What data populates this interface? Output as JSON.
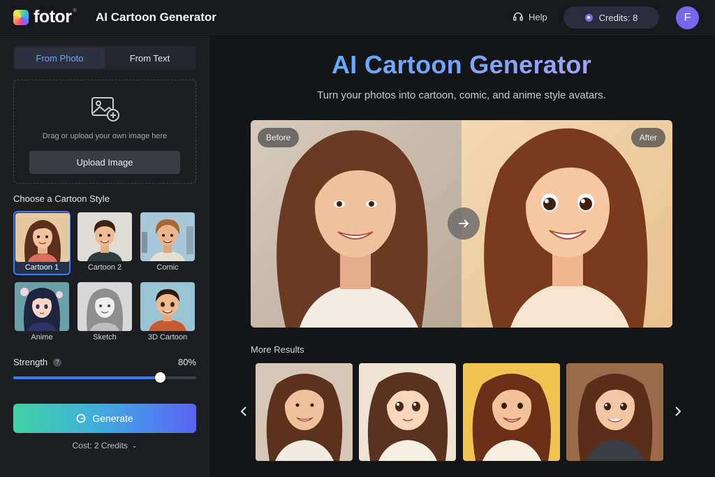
{
  "header": {
    "logo_text": "fotor",
    "logo_trademark": "®",
    "app_title": "AI Cartoon Generator",
    "help_label": "Help",
    "credits_label": "Credits: 8",
    "avatar_initial": "F"
  },
  "sidebar": {
    "tabs": [
      {
        "label": "From Photo",
        "active": true
      },
      {
        "label": "From Text",
        "active": false
      }
    ],
    "upload": {
      "hint": "Drag or upload your own image here",
      "button_label": "Upload Image"
    },
    "style_section_label": "Choose a Cartoon Style",
    "styles": [
      {
        "label": "Cartoon 1",
        "selected": true
      },
      {
        "label": "Cartoon 2",
        "selected": false
      },
      {
        "label": "Comic",
        "selected": false
      },
      {
        "label": "Anime",
        "selected": false
      },
      {
        "label": "Sketch",
        "selected": false
      },
      {
        "label": "3D Cartoon",
        "selected": false
      }
    ],
    "strength": {
      "label": "Strength",
      "value_label": "80%",
      "value": 0.8
    },
    "generate_label": "Generate",
    "cost_label": "Cost: 2 Credits"
  },
  "main": {
    "title": "AI Cartoon Generator",
    "subtitle": "Turn your photos into cartoon, comic, and anime style avatars.",
    "compare": {
      "before_label": "Before",
      "after_label": "After"
    },
    "more_results_label": "More Results"
  },
  "colors": {
    "accent": "#3f7cf5",
    "background": "#141517",
    "sidebar": "#1d1e22",
    "credits_pill": "#2a2c3d",
    "avatar": "#7b66f0"
  },
  "icons": {
    "help": "headset-icon",
    "credits": "credit-coin-icon",
    "upload": "image-add-icon",
    "generate": "generate-icon",
    "cost_dropdown": "chevron-down-icon",
    "compare": "arrow-right-icon",
    "results_prev": "chevron-left-icon",
    "results_next": "chevron-right-icon"
  }
}
